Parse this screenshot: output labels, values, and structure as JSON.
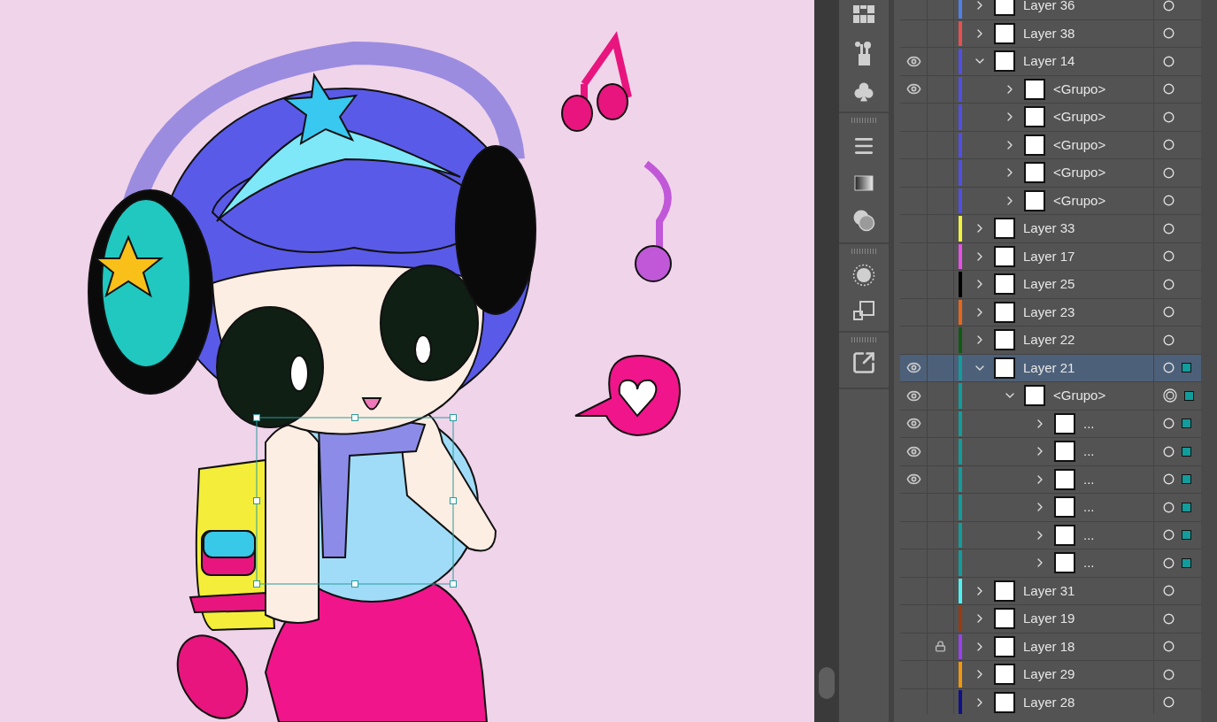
{
  "layers": [
    {
      "name": "Layer 36",
      "visible": false,
      "locked": false,
      "expanded": false,
      "selected": false,
      "targeted": false,
      "has_selection": false,
      "color": "#4f7fe8"
    },
    {
      "name": "Layer 38",
      "visible": false,
      "locked": false,
      "expanded": false,
      "selected": false,
      "targeted": false,
      "has_selection": false,
      "color": "#e84f4f"
    },
    {
      "name": "Layer 14",
      "visible": true,
      "locked": false,
      "expanded": true,
      "selected": false,
      "targeted": false,
      "has_selection": false,
      "color": "#4f4fe8",
      "children": [
        {
          "name": "<Grupo>",
          "visible": true,
          "locked": false,
          "expanded": false,
          "selected": false,
          "targeted": false,
          "has_selection": false,
          "color": "#4f4fe8"
        },
        {
          "name": "<Grupo>",
          "visible": false,
          "locked": false,
          "expanded": false,
          "selected": false,
          "targeted": false,
          "has_selection": false,
          "color": "#4f4fe8"
        },
        {
          "name": "<Grupo>",
          "visible": false,
          "locked": false,
          "expanded": false,
          "selected": false,
          "targeted": false,
          "has_selection": false,
          "color": "#4f4fe8"
        },
        {
          "name": "<Grupo>",
          "visible": false,
          "locked": false,
          "expanded": false,
          "selected": false,
          "targeted": false,
          "has_selection": false,
          "color": "#4f4fe8"
        },
        {
          "name": "<Grupo>",
          "visible": false,
          "locked": false,
          "expanded": false,
          "selected": false,
          "targeted": false,
          "has_selection": false,
          "color": "#4f4fe8"
        }
      ]
    },
    {
      "name": "Layer 33",
      "visible": false,
      "locked": false,
      "expanded": false,
      "selected": false,
      "targeted": false,
      "has_selection": false,
      "color": "#f0f040"
    },
    {
      "name": "Layer 17",
      "visible": false,
      "locked": false,
      "expanded": false,
      "selected": false,
      "targeted": false,
      "has_selection": false,
      "color": "#e84fe8"
    },
    {
      "name": "Layer 25",
      "visible": false,
      "locked": false,
      "expanded": false,
      "selected": false,
      "targeted": false,
      "has_selection": false,
      "color": "#000000"
    },
    {
      "name": "Layer 23",
      "visible": false,
      "locked": false,
      "expanded": false,
      "selected": false,
      "targeted": false,
      "has_selection": false,
      "color": "#e8661a"
    },
    {
      "name": "Layer 22",
      "visible": false,
      "locked": false,
      "expanded": false,
      "selected": false,
      "targeted": false,
      "has_selection": false,
      "color": "#0e5a14"
    },
    {
      "name": "Layer 21",
      "visible": true,
      "locked": false,
      "expanded": true,
      "selected": true,
      "targeted": false,
      "has_selection": true,
      "color": "#129c9c",
      "children": [
        {
          "name": "<Grupo>",
          "visible": true,
          "locked": false,
          "expanded": true,
          "selected": false,
          "targeted": true,
          "has_selection": true,
          "color": "#129c9c",
          "children": [
            {
              "name": "...",
              "visible": true,
              "locked": false,
              "expanded": false,
              "selected": false,
              "targeted": false,
              "has_selection": true,
              "color": "#129c9c"
            },
            {
              "name": "...",
              "visible": true,
              "locked": false,
              "expanded": false,
              "selected": false,
              "targeted": false,
              "has_selection": true,
              "color": "#129c9c"
            },
            {
              "name": "...",
              "visible": true,
              "locked": false,
              "expanded": false,
              "selected": false,
              "targeted": false,
              "has_selection": true,
              "color": "#129c9c"
            },
            {
              "name": "...",
              "visible": false,
              "locked": false,
              "expanded": false,
              "selected": false,
              "targeted": false,
              "has_selection": true,
              "color": "#129c9c"
            },
            {
              "name": "...",
              "visible": false,
              "locked": false,
              "expanded": false,
              "selected": false,
              "targeted": false,
              "has_selection": true,
              "color": "#129c9c"
            },
            {
              "name": "...",
              "visible": false,
              "locked": false,
              "expanded": false,
              "selected": false,
              "targeted": false,
              "has_selection": true,
              "color": "#129c9c"
            }
          ]
        }
      ]
    },
    {
      "name": "Layer 31",
      "visible": false,
      "locked": false,
      "expanded": false,
      "selected": false,
      "targeted": false,
      "has_selection": false,
      "color": "#4ff0f0"
    },
    {
      "name": "Layer 19",
      "visible": false,
      "locked": false,
      "expanded": false,
      "selected": false,
      "targeted": false,
      "has_selection": false,
      "color": "#9c3a10"
    },
    {
      "name": "Layer 18",
      "visible": false,
      "locked": true,
      "expanded": false,
      "selected": false,
      "targeted": false,
      "has_selection": false,
      "color": "#9a40f0"
    },
    {
      "name": "Layer 29",
      "visible": false,
      "locked": false,
      "expanded": false,
      "selected": false,
      "targeted": false,
      "has_selection": false,
      "color": "#f0960f"
    },
    {
      "name": "Layer 28",
      "visible": false,
      "locked": false,
      "expanded": false,
      "selected": false,
      "targeted": false,
      "has_selection": false,
      "color": "#10108a"
    }
  ]
}
